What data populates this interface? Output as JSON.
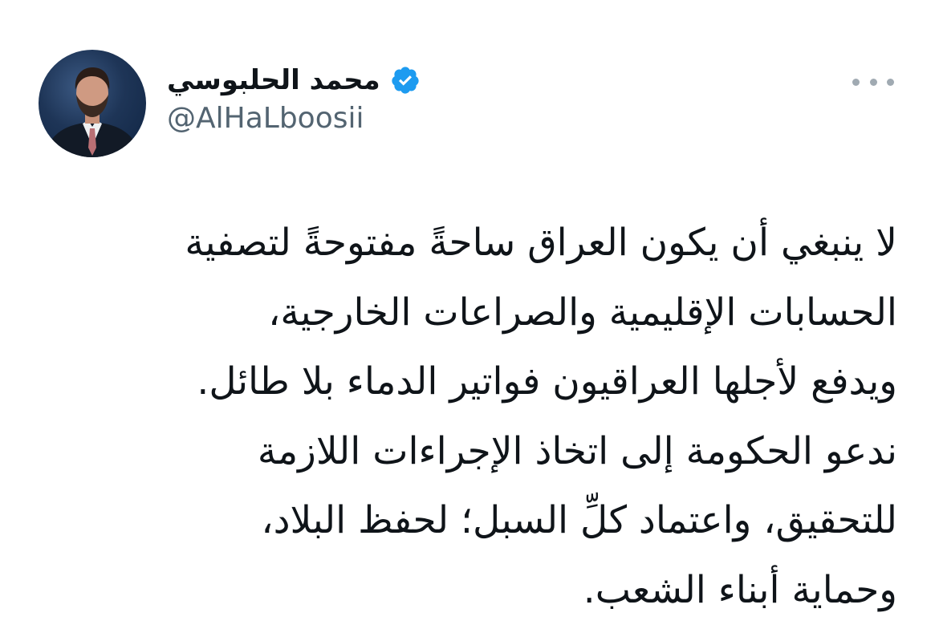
{
  "author": {
    "display_name": "محمد الحلبوسي",
    "handle": "@AlHaLboosii",
    "verified": true,
    "verified_color": "#1d9bf0"
  },
  "icons": {
    "verified": "verified-badge-icon",
    "more": "more-horizontal-icon"
  },
  "tweet": {
    "lines": [
      "لا ينبغي أن يكون العراق ساحةً مفتوحةً لتصفية",
      "الحسابات الإقليمية والصراعات الخارجية،",
      "ويدفع لأجلها العراقيون فواتير الدماء بلا طائل.",
      "ندعو الحكومة إلى اتخاذ الإجراءات اللازمة",
      "للتحقيق، واعتماد كلِّ السبل؛ لحفظ البلاد،",
      "وحماية أبناء الشعب."
    ]
  },
  "colors": {
    "text": "#0f1419",
    "secondary": "#536471",
    "background": "#ffffff"
  }
}
